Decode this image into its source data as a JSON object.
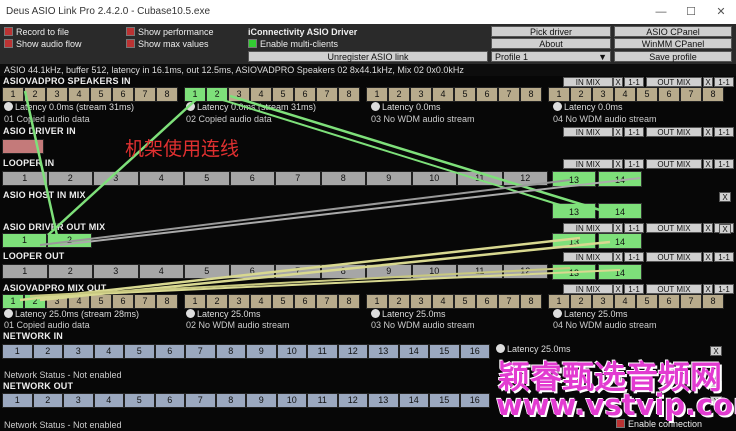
{
  "window": {
    "title": "Deus ASIO Link Pro 2.4.2.0 - Cubase10.5.exe"
  },
  "top": {
    "record": "Record to file",
    "show_perf": "Show performance",
    "show_flow": "Show audio flow",
    "show_max": "Show max values",
    "driver_name": "iConnectivity ASIO Driver",
    "multi": "Enable multi-clients",
    "unregister": "Unregister ASIO link",
    "profile": "Profile 1",
    "pick": "Pick driver",
    "about": "About",
    "asio_cpanel": "ASIO CPanel",
    "winmm": "WinMM CPanel",
    "save": "Save profile"
  },
  "status": "ASIO 44.1kHz, buffer 512, latency in 16.1ms, out 12.5ms, ASIOVADPRO Speakers 02 8x44.1kHz, Mix 02 0x0.0kHz",
  "buttons": {
    "in_mix": "IN MIX",
    "out_mix": "OUT MIX",
    "x": "X",
    "one": "1-1"
  },
  "sections": {
    "speakers_in": "ASIOVADPRO SPEAKERS IN",
    "driver_in": "ASIO DRIVER IN",
    "looper_in": "LOOPER IN",
    "host_in_mix": "ASIO HOST IN MIX",
    "driver_out_mix": "ASIO DRIVER OUT MIX",
    "looper_out": "LOOPER OUT",
    "mix_out": "ASIOVADPRO MIX OUT",
    "network_in": "NETWORK IN",
    "network_out": "NETWORK OUT"
  },
  "speakers_in": {
    "lat1": "Latency 0.0ms (stream 31ms)",
    "lat2": "Latency 0.0ms (stream 31ms)",
    "lat3": "Latency 0.0ms",
    "lat4": "Latency 0.0ms",
    "s1": "01 Copied audio data",
    "s2": "02 Copied audio data",
    "s3": "03 No WDM audio stream",
    "s4": "04 No WDM audio stream"
  },
  "mix_out": {
    "lat1": "Latency 25.0ms (stream 28ms)",
    "lat2": "Latency 25.0ms",
    "lat3": "Latency 25.0ms",
    "lat4": "Latency 25.0ms",
    "s1": "01 Copied audio data",
    "s2": "02 No WDM audio stream",
    "s3": "03 No WDM audio stream",
    "s4": "04 No WDM audio stream"
  },
  "network": {
    "status_in": "Network Status - Not enabled",
    "status_out": "Network Status - Not enabled",
    "lat": "Latency 25.0ms",
    "enable": "Enable connection"
  },
  "annotation": "机架使用连线",
  "watermark": {
    "cn": "颖睿甄选音频网",
    "url": "www.vstvip.com"
  },
  "colors": {
    "green": "#7ee07a",
    "line": "#d8d890",
    "tan": "#b8ab8c",
    "blue": "#9ba8bf",
    "watermark": "#e23bd1",
    "annotation": "#e03030"
  }
}
